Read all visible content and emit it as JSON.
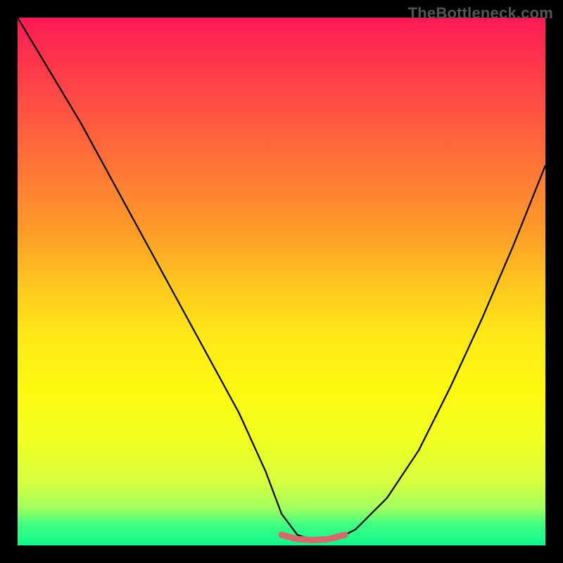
{
  "watermark": "TheBottleneck.com",
  "chart_data": {
    "type": "line",
    "title": "",
    "xlabel": "",
    "ylabel": "",
    "xlim": [
      0,
      100
    ],
    "ylim": [
      0,
      100
    ],
    "series": [
      {
        "name": "main-curve",
        "x": [
          0,
          6,
          12,
          18,
          24,
          30,
          36,
          42,
          47,
          50,
          53,
          56,
          60,
          64,
          70,
          76,
          82,
          88,
          94,
          100
        ],
        "values": [
          100,
          90,
          80,
          69,
          58,
          47,
          36,
          25,
          14,
          6,
          2,
          1,
          1,
          3,
          9,
          18,
          30,
          43,
          57,
          72
        ]
      },
      {
        "name": "highlight-flat",
        "x": [
          50,
          53,
          56,
          59,
          62
        ],
        "values": [
          2,
          1.2,
          1,
          1.2,
          2
        ]
      }
    ],
    "colors": {
      "background_gradient_top": "#ff1a55",
      "background_gradient_bottom": "#10f890",
      "curve": "#000000",
      "highlight": "#d46a6a",
      "frame": "#000000"
    }
  }
}
